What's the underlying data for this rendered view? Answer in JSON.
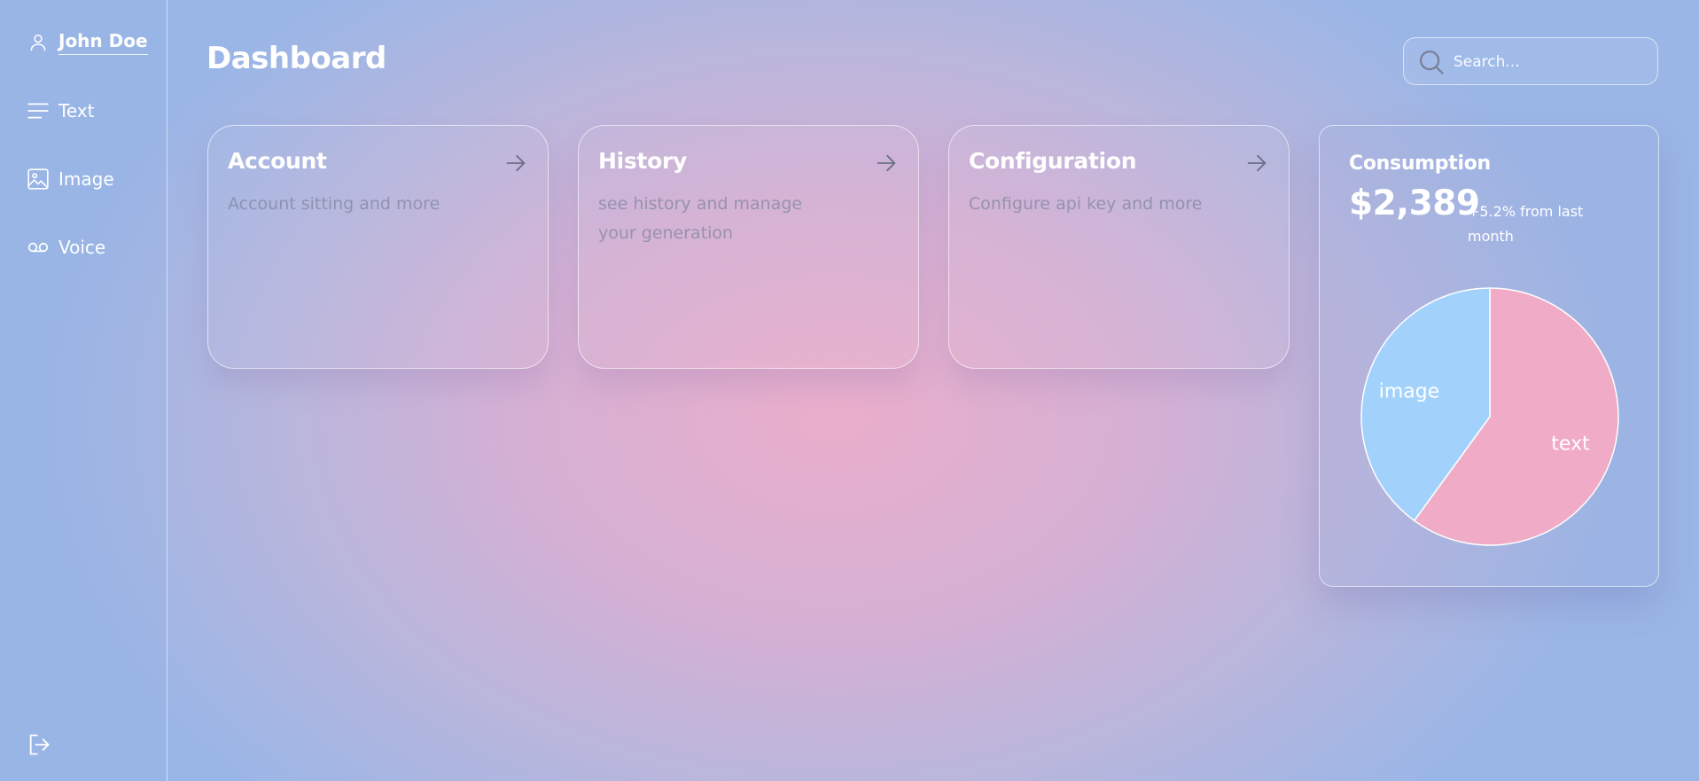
{
  "sidebar": {
    "user_name": "John Doe",
    "items": [
      {
        "label": "Text",
        "icon": "menu-lines-icon"
      },
      {
        "label": "Image",
        "icon": "image-icon"
      },
      {
        "label": "Voice",
        "icon": "voicemail-icon"
      }
    ],
    "logout_icon": "logout-icon"
  },
  "header": {
    "title": "Dashboard",
    "search_placeholder": "Search..."
  },
  "cards": [
    {
      "title": "Account",
      "description": "Account sitting and more"
    },
    {
      "title": "History",
      "description": "see history and manage your generation"
    },
    {
      "title": "Configuration",
      "description": "Configure api key and more"
    }
  ],
  "consumption": {
    "title": "Consumption",
    "amount": "$2,389",
    "change": "+5.2% from last month"
  },
  "chart_data": {
    "type": "pie",
    "slices": [
      {
        "label": "text",
        "value": 60,
        "color": "#f0abc7"
      },
      {
        "label": "image",
        "value": 40,
        "color": "#a2d2fb"
      }
    ]
  }
}
